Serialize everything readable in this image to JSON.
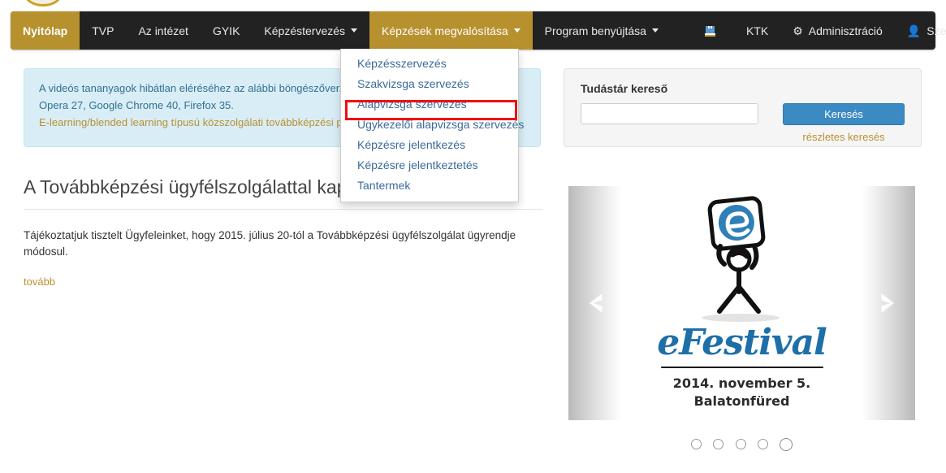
{
  "navbar": {
    "items": [
      {
        "label": "Nyitólap",
        "state": "active",
        "caret": false
      },
      {
        "label": "TVP",
        "state": "normal",
        "caret": false
      },
      {
        "label": "Az intézet",
        "state": "normal",
        "caret": false
      },
      {
        "label": "GYIK",
        "state": "normal",
        "caret": false
      },
      {
        "label": "Képzéstervezés",
        "state": "normal",
        "caret": true
      },
      {
        "label": "Képzések megvalósítása",
        "state": "open",
        "caret": true
      },
      {
        "label": "Program benyújtása",
        "state": "normal",
        "caret": true
      }
    ],
    "right_items": [
      {
        "label": "",
        "icon": "tower-icon"
      },
      {
        "label": "KTK",
        "icon": ""
      },
      {
        "label": "Adminisztráció",
        "icon": "gear-icon"
      },
      {
        "label": "Személyes oldalam",
        "icon": "user-icon"
      }
    ]
  },
  "dropdown": {
    "items": [
      {
        "label": "Képzésszervezés",
        "highlighted": false
      },
      {
        "label": "Szakvizsga szervezés",
        "highlighted": false
      },
      {
        "label": "Alapvizsga szervezés",
        "highlighted": false
      },
      {
        "label": "Ügykezelői alapvizsga szervezés",
        "highlighted": true
      },
      {
        "label": "Képzésre jelentkezés",
        "highlighted": false
      },
      {
        "label": "Képzésre jelentkeztetés",
        "highlighted": false
      },
      {
        "label": "Tantermek",
        "highlighted": false
      }
    ],
    "highlight_color": "#ee1111"
  },
  "alert": {
    "line1": "A videós tananyagok hibátlan eléréséhez az alábbi böngészőverziók szükségesek:",
    "line2": "Opera 27, Google Chrome 40, Firefox 35.",
    "line3": "E-learning/blended learning típusú közszolgálati továbbképzési programok résztvevők figyelmébe!"
  },
  "search": {
    "title": "Tudástár kereső",
    "input_value": "",
    "input_placeholder": "",
    "button_label": "Keresés",
    "advanced_label": "részletes keresés"
  },
  "article": {
    "title": "A Továbbképzési ügyfélszolgálattal kapcsolatos változások",
    "body": "Tájékoztatjuk tisztelt Ügyfeleinket, hogy 2015. július 20-tól a Továbbképzési ügyfélszolgálat ügyrendje módosul.",
    "more_label": "tovább"
  },
  "carousel": {
    "banner": {
      "wordmark": "eFestival",
      "date_line1": "2014. november 5.",
      "date_line2": "Balatonfüred"
    },
    "prev_label": "‹",
    "next_label": "›",
    "dots": [
      {
        "active": false
      },
      {
        "active": false
      },
      {
        "active": false
      },
      {
        "active": false
      },
      {
        "active": true
      }
    ]
  },
  "colors": {
    "navbar_bg": "#222222",
    "accent_gold": "#b8912f",
    "link_blue": "#3a6a9a",
    "info_bg": "#d9edf7",
    "info_border": "#bce8f1",
    "button_blue": "#3b8ac4",
    "highlight_red": "#ee1111"
  }
}
